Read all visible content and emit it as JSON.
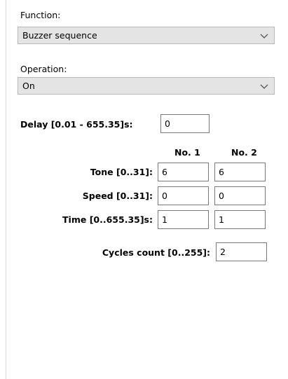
{
  "function": {
    "label": "Function:",
    "value": "Buzzer sequence"
  },
  "operation": {
    "label": "Operation:",
    "value": "On"
  },
  "delay": {
    "label": "Delay [0.01 - 655.35]s:",
    "value": "0"
  },
  "columns": [
    "No. 1",
    "No. 2"
  ],
  "rows": [
    {
      "label": "Tone [0..31]:",
      "values": [
        "6",
        "6"
      ]
    },
    {
      "label": "Speed [0..31]:",
      "values": [
        "0",
        "0"
      ]
    },
    {
      "label": "Time [0..655.35]s:",
      "values": [
        "1",
        "1"
      ]
    }
  ],
  "cycles": {
    "label": "Cycles count [0..255]:",
    "value": "2"
  },
  "icons": {
    "dropdown": "chevron-down-icon"
  }
}
